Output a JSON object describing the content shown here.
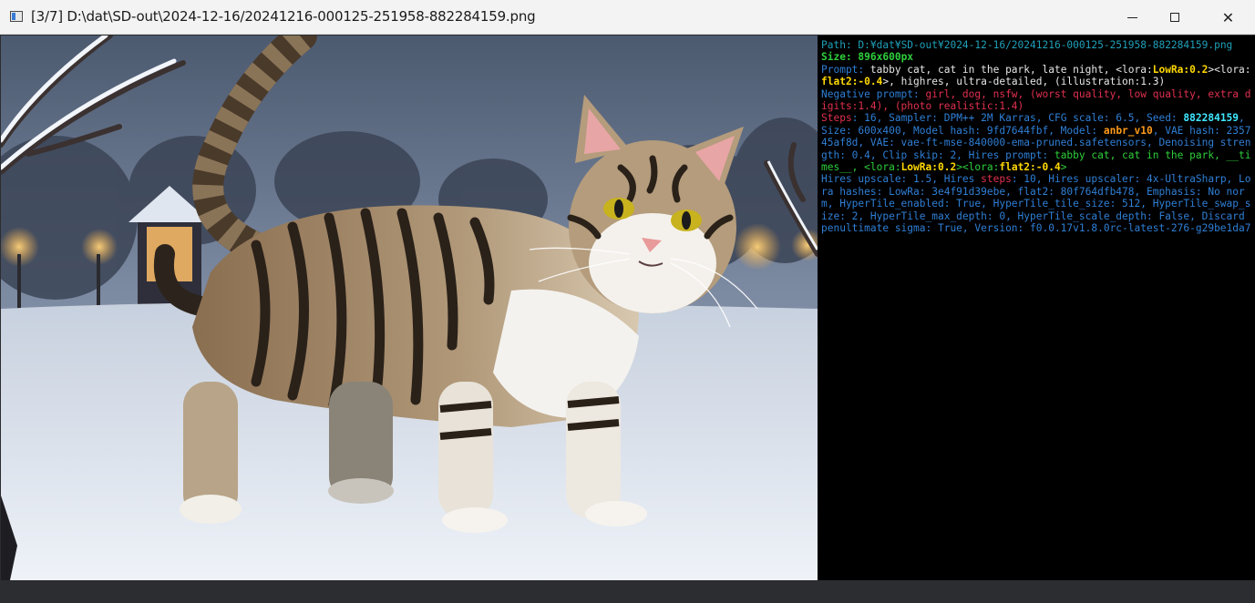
{
  "window": {
    "title": "[3/7] D:\\dat\\SD-out\\2024-12-16/20241216-000125-251958-882284159.png",
    "minimize_glyph": "",
    "maximize_glyph": "",
    "close_glyph": "✕"
  },
  "image": {
    "description_icon": "tabby-cat-in-snow-image"
  },
  "info": {
    "path_label": "Path: ",
    "path_value": "D:¥dat¥SD-out¥2024-12-16/20241216-000125-251958-882284159.png",
    "size_label": "Size: ",
    "size_value": "896x600px",
    "prompt_label": "Prompt: ",
    "prompt_p1": "tabby cat, cat in the park, late night, <lora:",
    "prompt_lora1_name": "LowRa",
    "prompt_lora1_weight": ":0.2",
    "prompt_p2": "><lora:",
    "prompt_lora2_name": "flat2",
    "prompt_lora2_weight": ":-0.4",
    "prompt_p3": ">, highres, ultra-detailed, (illustration:1.3)",
    "neg_label": "Negative prompt: ",
    "neg_value": "girl, dog, nsfw, (worst quality, low quality, extra digits:1.4), (photo realistic:1.4)",
    "steps_label": "Steps",
    "params_p1": ": 16, Sampler: DPM++ 2M Karras, CFG scale: 6.5, Seed: ",
    "seed_value": "882284159",
    "params_p2": ", Size: 600x400, Model hash: 9fd7644fbf, Model: ",
    "model_value": "anbr_v10",
    "params_p3": ", VAE hash: 235745af8d, VAE: vae-ft-mse-840000-ema-pruned.safetensors, Denoising strength: 0.4, Clip skip: 2, Hires prompt: ",
    "hires_prompt_p1": "tabby cat, cat in the park, __times__, <lora:",
    "hires_lora1_name": "LowRa",
    "hires_lora1_weight": ":0.2",
    "hires_p2": "><lora:",
    "hires_lora2_name": "flat2",
    "hires_lora2_weight": ":-0.4",
    "hires_p3": ">",
    "params_p4": "Hires upscale: 1.5, Hires ",
    "hires_steps_label": "steps",
    "params_p5": ": 10, Hires upscaler: 4x-UltraSharp, Lora hashes: LowRa: 3e4f91d39ebe, flat2: 80f764dfb478, Emphasis: No norm, HyperTile_enabled: True, HyperTile_tile_size: 512, HyperTile_swap_size: 2, HyperTile_max_depth: 0, HyperTile_scale_depth: False, Discard penultimate sigma: True, Version: f0.0.17v1.8.0rc-latest-276-g29be1da7"
  },
  "colors": {
    "label": "#1fa0b8",
    "size_green": "#2ecf3c",
    "prompt_white": "#e6e6e6",
    "lora_yellow": "#ffd800",
    "negative_red": "#e0304f",
    "seed_cyan": "#3fe8ff",
    "model_orange": "#ff9a1a",
    "params_blue": "#2f7fd6"
  }
}
